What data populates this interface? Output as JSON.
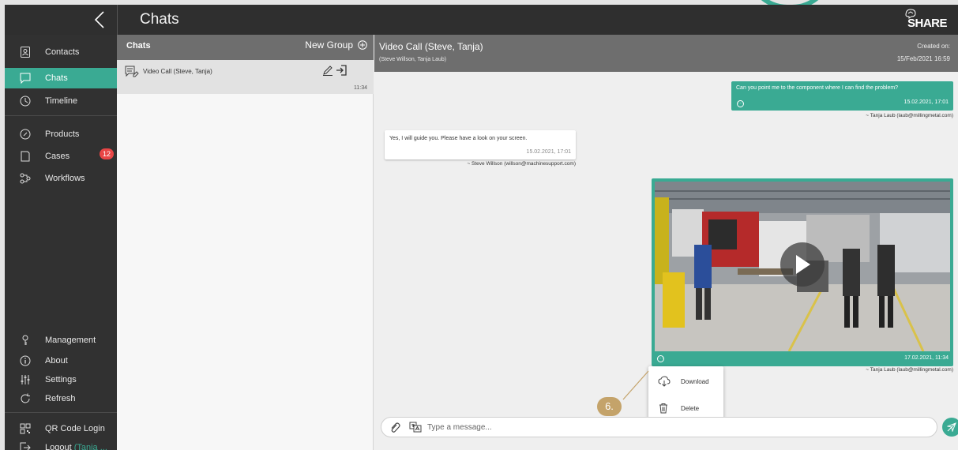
{
  "topbar": {
    "title": "Chats",
    "brand": "SHARE"
  },
  "sidebar": {
    "items": [
      {
        "label": "Contacts",
        "icon": "contacts-icon"
      },
      {
        "label": "Chats",
        "icon": "chat-icon"
      },
      {
        "label": "Timeline",
        "icon": "timeline-icon"
      },
      {
        "label": "Products",
        "icon": "products-icon"
      },
      {
        "label": "Cases",
        "icon": "cases-icon",
        "badge": "12"
      },
      {
        "label": "Workflows",
        "icon": "workflows-icon"
      }
    ],
    "bottom": [
      {
        "label": "Management",
        "icon": "management-icon"
      },
      {
        "label": "About",
        "icon": "info-icon"
      },
      {
        "label": "Settings",
        "icon": "settings-icon"
      },
      {
        "label": "Refresh",
        "icon": "refresh-icon"
      },
      {
        "label": "QR Code Login",
        "icon": "qr-code-icon"
      },
      {
        "label": "Logout",
        "icon": "logout-icon",
        "user": "(Tanja ..."
      }
    ]
  },
  "chatlist": {
    "header": "Chats",
    "new_group": "New Group",
    "items": [
      {
        "name": "Video Call (Steve, Tanja)",
        "time": "11:34"
      }
    ]
  },
  "conversation": {
    "title": "Video Call (Steve, Tanja)",
    "participants": "(Steve Willson, Tanja Laub)",
    "created_label": "Created on:",
    "created_value": "15/Feb/2021 16:59",
    "messages": [
      {
        "text": "Can you point me to the component where I can find the problem?",
        "time": "15.02.2021, 17:01",
        "sender": "~ Tanja Laub (laub@millingmetal.com)"
      },
      {
        "text": "Yes, I will guide you. Please have a look on your screen.",
        "time": "15.02.2021, 17:01",
        "sender": "~ Steve Willson (willson@machinesupport.com)"
      },
      {
        "time": "17.02.2021, 11:34",
        "sender": "~ Tanja Laub (laub@millingmetal.com)"
      }
    ],
    "context_menu": {
      "download": "Download",
      "delete": "Delete"
    },
    "callout": "6.",
    "input_placeholder": "Type a message..."
  },
  "colors": {
    "accent": "#3aaa93",
    "sidebar": "#313131",
    "badge": "#e84545"
  }
}
